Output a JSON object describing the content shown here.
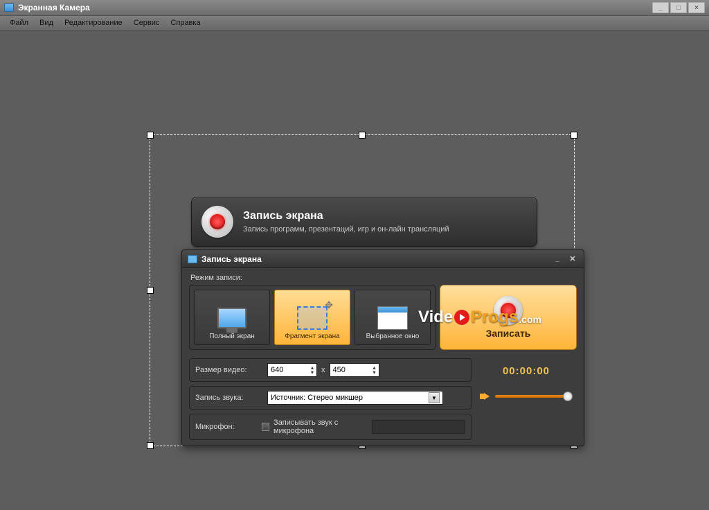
{
  "window": {
    "title": "Экранная Камера"
  },
  "menu": {
    "file": "Файл",
    "view": "Вид",
    "edit": "Редактирование",
    "service": "Сервис",
    "help": "Справка"
  },
  "banner": {
    "title": "Запись экрана",
    "subtitle": "Запись программ, презентаций, игр и он-лайн трансляций"
  },
  "dialog": {
    "title": "Запись экрана",
    "mode_label": "Режим записи:",
    "modes": {
      "full": "Полный экран",
      "fragment": "Фрагмент экрана",
      "window": "Выбранное окно"
    },
    "record_label": "Записать",
    "size_label": "Размер видео:",
    "width": "640",
    "height": "450",
    "sound_label": "Запись звука:",
    "sound_source": "Источник: Стерео микшер",
    "mic_label": "Микрофон:",
    "mic_checkbox": "Записывать звук с микрофона",
    "timer": "00:00:00",
    "x_separator": "x"
  },
  "watermark": {
    "part1": "Vide",
    "part2": "Progs",
    "part3": ".com"
  }
}
